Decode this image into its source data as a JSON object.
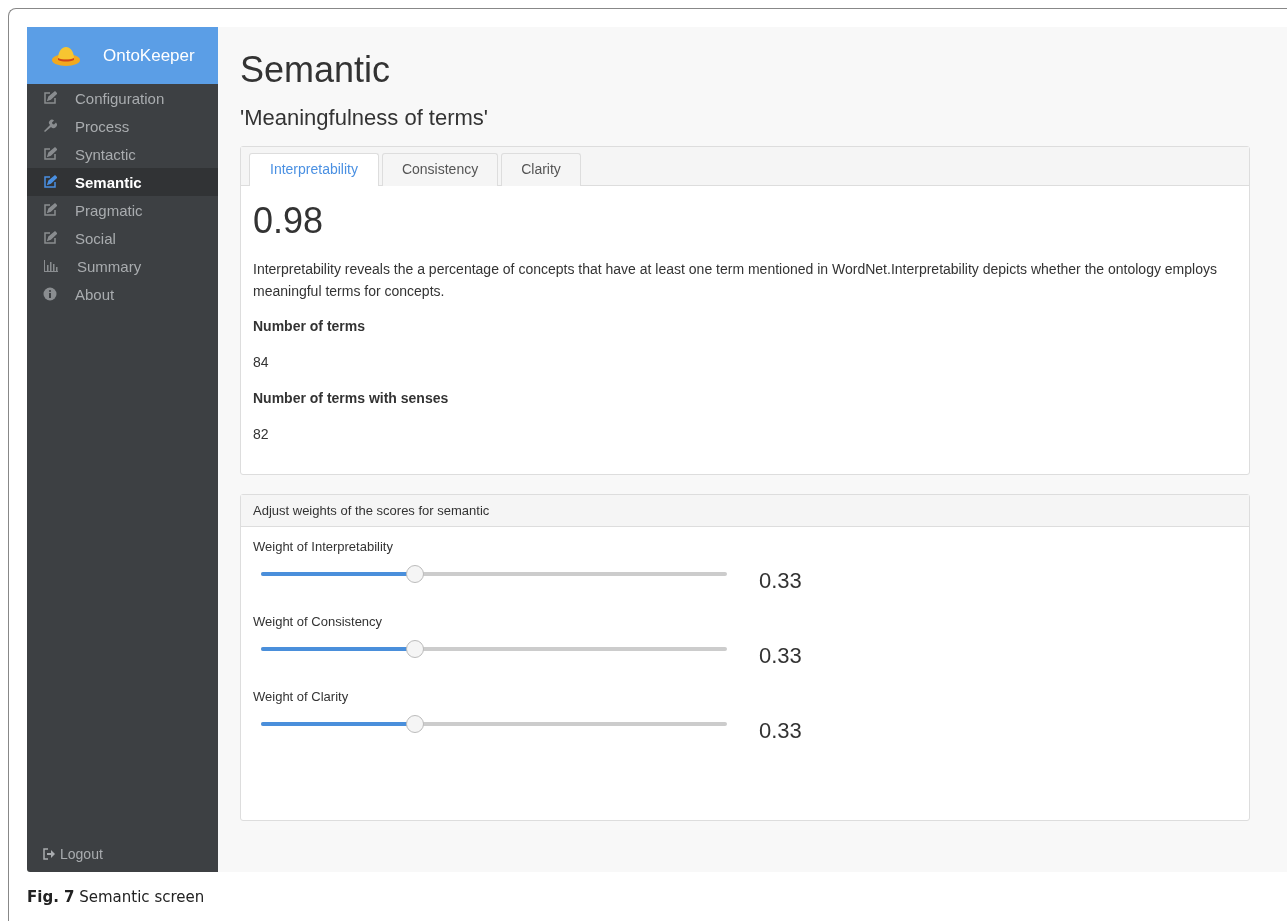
{
  "sidebar": {
    "brand": "OntoKeeper",
    "items": [
      {
        "label": "Configuration",
        "kind": "edit",
        "selected": false
      },
      {
        "label": "Process",
        "kind": "wrench",
        "selected": false
      },
      {
        "label": "Syntactic",
        "kind": "edit",
        "selected": false
      },
      {
        "label": "Semantic",
        "kind": "edit",
        "selected": true
      },
      {
        "label": "Pragmatic",
        "kind": "edit",
        "selected": false
      },
      {
        "label": "Social",
        "kind": "edit",
        "selected": false
      },
      {
        "label": "Summary",
        "kind": "chart",
        "selected": false
      },
      {
        "label": "About",
        "kind": "info",
        "selected": false
      }
    ],
    "logout": "Logout"
  },
  "page": {
    "title": "Semantic",
    "subtitle": "'Meaningfulness of terms'"
  },
  "tabs": [
    {
      "label": "Interpretability",
      "selected": true
    },
    {
      "label": "Consistency",
      "selected": false
    },
    {
      "label": "Clarity",
      "selected": false
    }
  ],
  "panel": {
    "score": "0.98",
    "description": "Interpretability reveals the a percentage of concepts that have at least one term mentioned in WordNet.Interpretability depicts whether the ontology employs meaningful terms for concepts.",
    "fields": [
      {
        "label": "Number of terms",
        "value": "84"
      },
      {
        "label": "Number of terms with senses",
        "value": "82"
      }
    ]
  },
  "weights": {
    "title": "Adjust weights of the scores for semantic",
    "sliders": [
      {
        "label": "Weight of Interpretability",
        "level": 0.33,
        "reading": "0.33"
      },
      {
        "label": "Weight of Consistency",
        "level": 0.33,
        "reading": "0.33"
      },
      {
        "label": "Weight of Clarity",
        "level": 0.33,
        "reading": "0.33"
      }
    ]
  },
  "caption": "**Fig. 7** Semantic screen"
}
